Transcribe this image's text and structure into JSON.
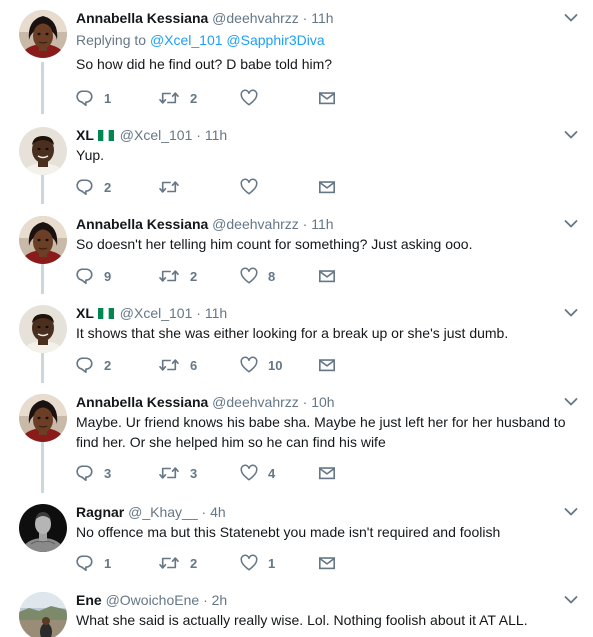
{
  "tweets": [
    {
      "name": "Annabella Kessiana",
      "handle": "@deehvahrzz",
      "separator": "·",
      "time": "11h",
      "replying_prefix": "Replying to",
      "replying_to": [
        "@Xcel_101",
        "@Sapphir3Diva"
      ],
      "text": "So how did he find out? D babe told him?",
      "replies": "1",
      "retweets": "2",
      "likes": ""
    },
    {
      "name": "XL",
      "flag": "nigeria-flag",
      "handle": "@Xcel_101",
      "separator": "·",
      "time": "11h",
      "text": "Yup.",
      "replies": "2",
      "retweets": "",
      "likes": ""
    },
    {
      "name": "Annabella Kessiana",
      "handle": "@deehvahrzz",
      "separator": "·",
      "time": "11h",
      "text": "So doesn't her telling him count for something? Just asking ooo.",
      "replies": "9",
      "retweets": "2",
      "likes": "8"
    },
    {
      "name": "XL",
      "flag": "nigeria-flag",
      "handle": "@Xcel_101",
      "separator": "·",
      "time": "11h",
      "text": "It shows that she was either looking for a break up or she's just dumb.",
      "replies": "2",
      "retweets": "6",
      "likes": "10"
    },
    {
      "name": "Annabella Kessiana",
      "handle": "@deehvahrzz",
      "separator": "·",
      "time": "10h",
      "text_lines": [
        "Maybe. Ur friend knows his babe sha. Maybe he just left her for her husband to",
        "find her. Or she helped him so he can find his wife"
      ],
      "replies": "3",
      "retweets": "3",
      "likes": "4"
    },
    {
      "name": "Ragnar",
      "handle": "@_Khay__",
      "separator": "·",
      "time": "4h",
      "text": "No offence ma but this Statenebt you made isn't required and foolish",
      "replies": "1",
      "retweets": "2",
      "likes": "1"
    },
    {
      "name": "Ene",
      "handle": "@OwoichoEne",
      "separator": "·",
      "time": "2h",
      "text": "What she said is actually really wise. Lol. Nothing foolish about it AT ALL."
    }
  ],
  "colors": {
    "text": "#14171a",
    "secondary": "#657786",
    "link": "#1da1f2",
    "thread_line": "#ccd6dd",
    "icon": "#657786",
    "flag_green": "#008751"
  },
  "icons": {
    "reply": "reply-icon",
    "retweet": "retweet-icon",
    "like": "heart-icon",
    "dm": "envelope-icon",
    "menu": "chevron-down-icon"
  }
}
